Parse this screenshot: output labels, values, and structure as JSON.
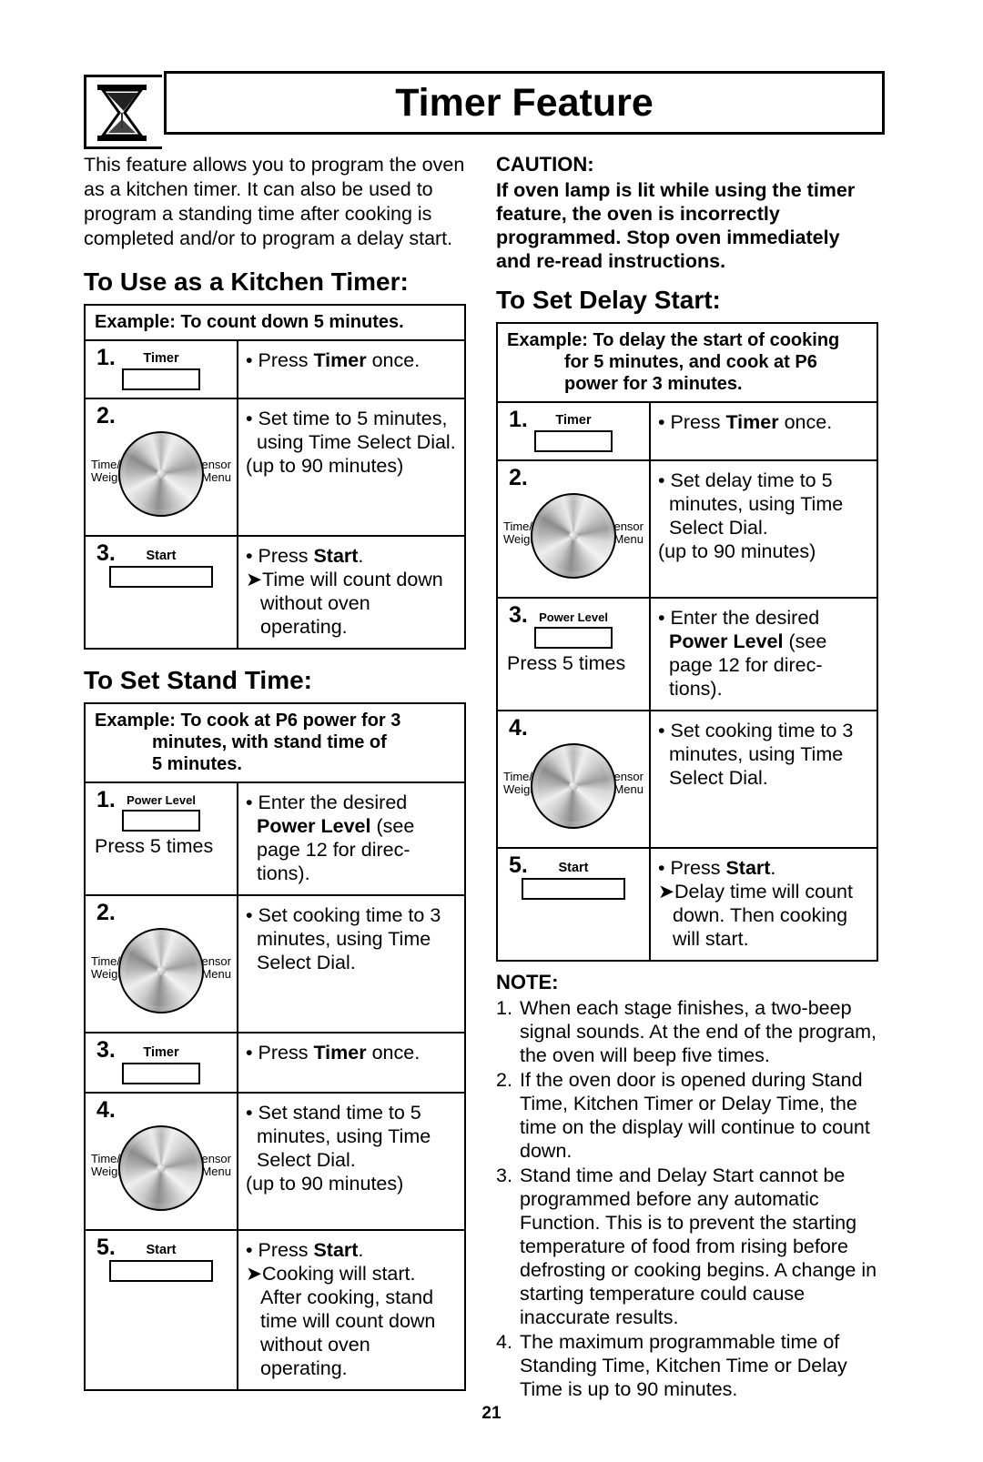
{
  "header": {
    "title": "Timer Feature",
    "icon": "hourglass-icon"
  },
  "intro": "This feature allows you to program the oven as a kitchen timer. It can also be used to program a standing time after cooking is completed and/or to program a delay start.",
  "caution": {
    "title": "CAUTION:",
    "body": "If oven lamp is lit while using the timer feature, the oven is incorrectly programmed. Stop oven immediately and re-read instructions."
  },
  "sections": {
    "kitchen_timer": {
      "heading": "To Use  as a Kitchen Timer:",
      "example": "Example: To count down 5 minutes.",
      "steps": [
        {
          "num": "1.",
          "button": "Timer",
          "control": "button",
          "lines": [
            "• Press Timer once."
          ]
        },
        {
          "num": "2.",
          "control": "dial",
          "dial_left": "Time/\nWeight",
          "dial_right": "Sensor\nMenu",
          "lines": [
            "• Set time to 5 minutes, using Time Select Dial.",
            "(up to 90 minutes)"
          ]
        },
        {
          "num": "3.",
          "button": "Start",
          "control": "button",
          "lines": [
            "• Press Start.",
            "➤ Time will count down without oven operating."
          ]
        }
      ]
    },
    "stand_time": {
      "heading": "To Set Stand Time:",
      "example_main": "Example: To cook at P6 power for 3",
      "example_cont": "minutes, with stand time of 5 minutes.",
      "steps": [
        {
          "num": "1.",
          "button": "Power Level",
          "control": "button",
          "extra": "Press 5 times",
          "lines": [
            "• Enter the desired Power Level (see page 12 for directions)."
          ]
        },
        {
          "num": "2.",
          "control": "dial",
          "dial_left": "Time/\nWeight",
          "dial_right": "Sensor\nMenu",
          "lines": [
            "• Set cooking time to 3 minutes, using Time Select Dial."
          ]
        },
        {
          "num": "3.",
          "button": "Timer",
          "control": "button",
          "lines": [
            "• Press Timer once."
          ]
        },
        {
          "num": "4.",
          "control": "dial",
          "dial_left": "Time/\nWeight",
          "dial_right": "Sensor\nMenu",
          "lines": [
            "• Set stand time to 5 minutes, using Time Select Dial.",
            "(up to 90 minutes)"
          ]
        },
        {
          "num": "5.",
          "button": "Start",
          "control": "button",
          "lines": [
            "• Press Start.",
            "➤ Cooking will start. After cooking, stand time will count down without oven operating."
          ]
        }
      ]
    },
    "delay_start": {
      "heading": "To Set Delay Start:",
      "example_main": "Example: To delay the start of cooking",
      "example_cont": "for 5 minutes, and cook at P6 power for 3 minutes.",
      "steps": [
        {
          "num": "1.",
          "button": "Timer",
          "control": "button",
          "lines": [
            "• Press Timer once."
          ]
        },
        {
          "num": "2.",
          "control": "dial",
          "dial_left": "Time/\nWeight",
          "dial_right": "Sensor\nMenu",
          "lines": [
            "• Set delay time to 5 minutes, using Time Select Dial.",
            "(up to 90 minutes)"
          ]
        },
        {
          "num": "3.",
          "button": "Power Level",
          "control": "button",
          "extra": "Press 5 times",
          "lines": [
            "• Enter the desired Power Level (see page 12 for directions)."
          ]
        },
        {
          "num": "4.",
          "control": "dial",
          "dial_left": "Time/\nWeight",
          "dial_right": "Sensor\nMenu",
          "lines": [
            "• Set cooking time to 3 minutes, using Time Select Dial."
          ]
        },
        {
          "num": "5.",
          "button": "Start",
          "control": "button",
          "lines": [
            "• Press Start.",
            "➤ Delay time will count down. Then cooking will start."
          ]
        }
      ]
    }
  },
  "note": {
    "title": "NOTE:",
    "items": [
      "When each stage finishes, a two-beep signal sounds. At the end of the program, the oven will beep five times.",
      "If the oven door is opened during Stand Time, Kitchen Timer or Delay Time, the time on the display will continue to count down.",
      "Stand time and Delay Start cannot be programmed before any automatic Function. This is to prevent the starting temperature of food from rising before defrosting or cooking begins. A change in starting temperature could cause inaccurate results.",
      "The maximum programmable time of Standing Time, Kitchen Time or Delay Time is up to 90 minutes."
    ]
  },
  "page_number": "21"
}
